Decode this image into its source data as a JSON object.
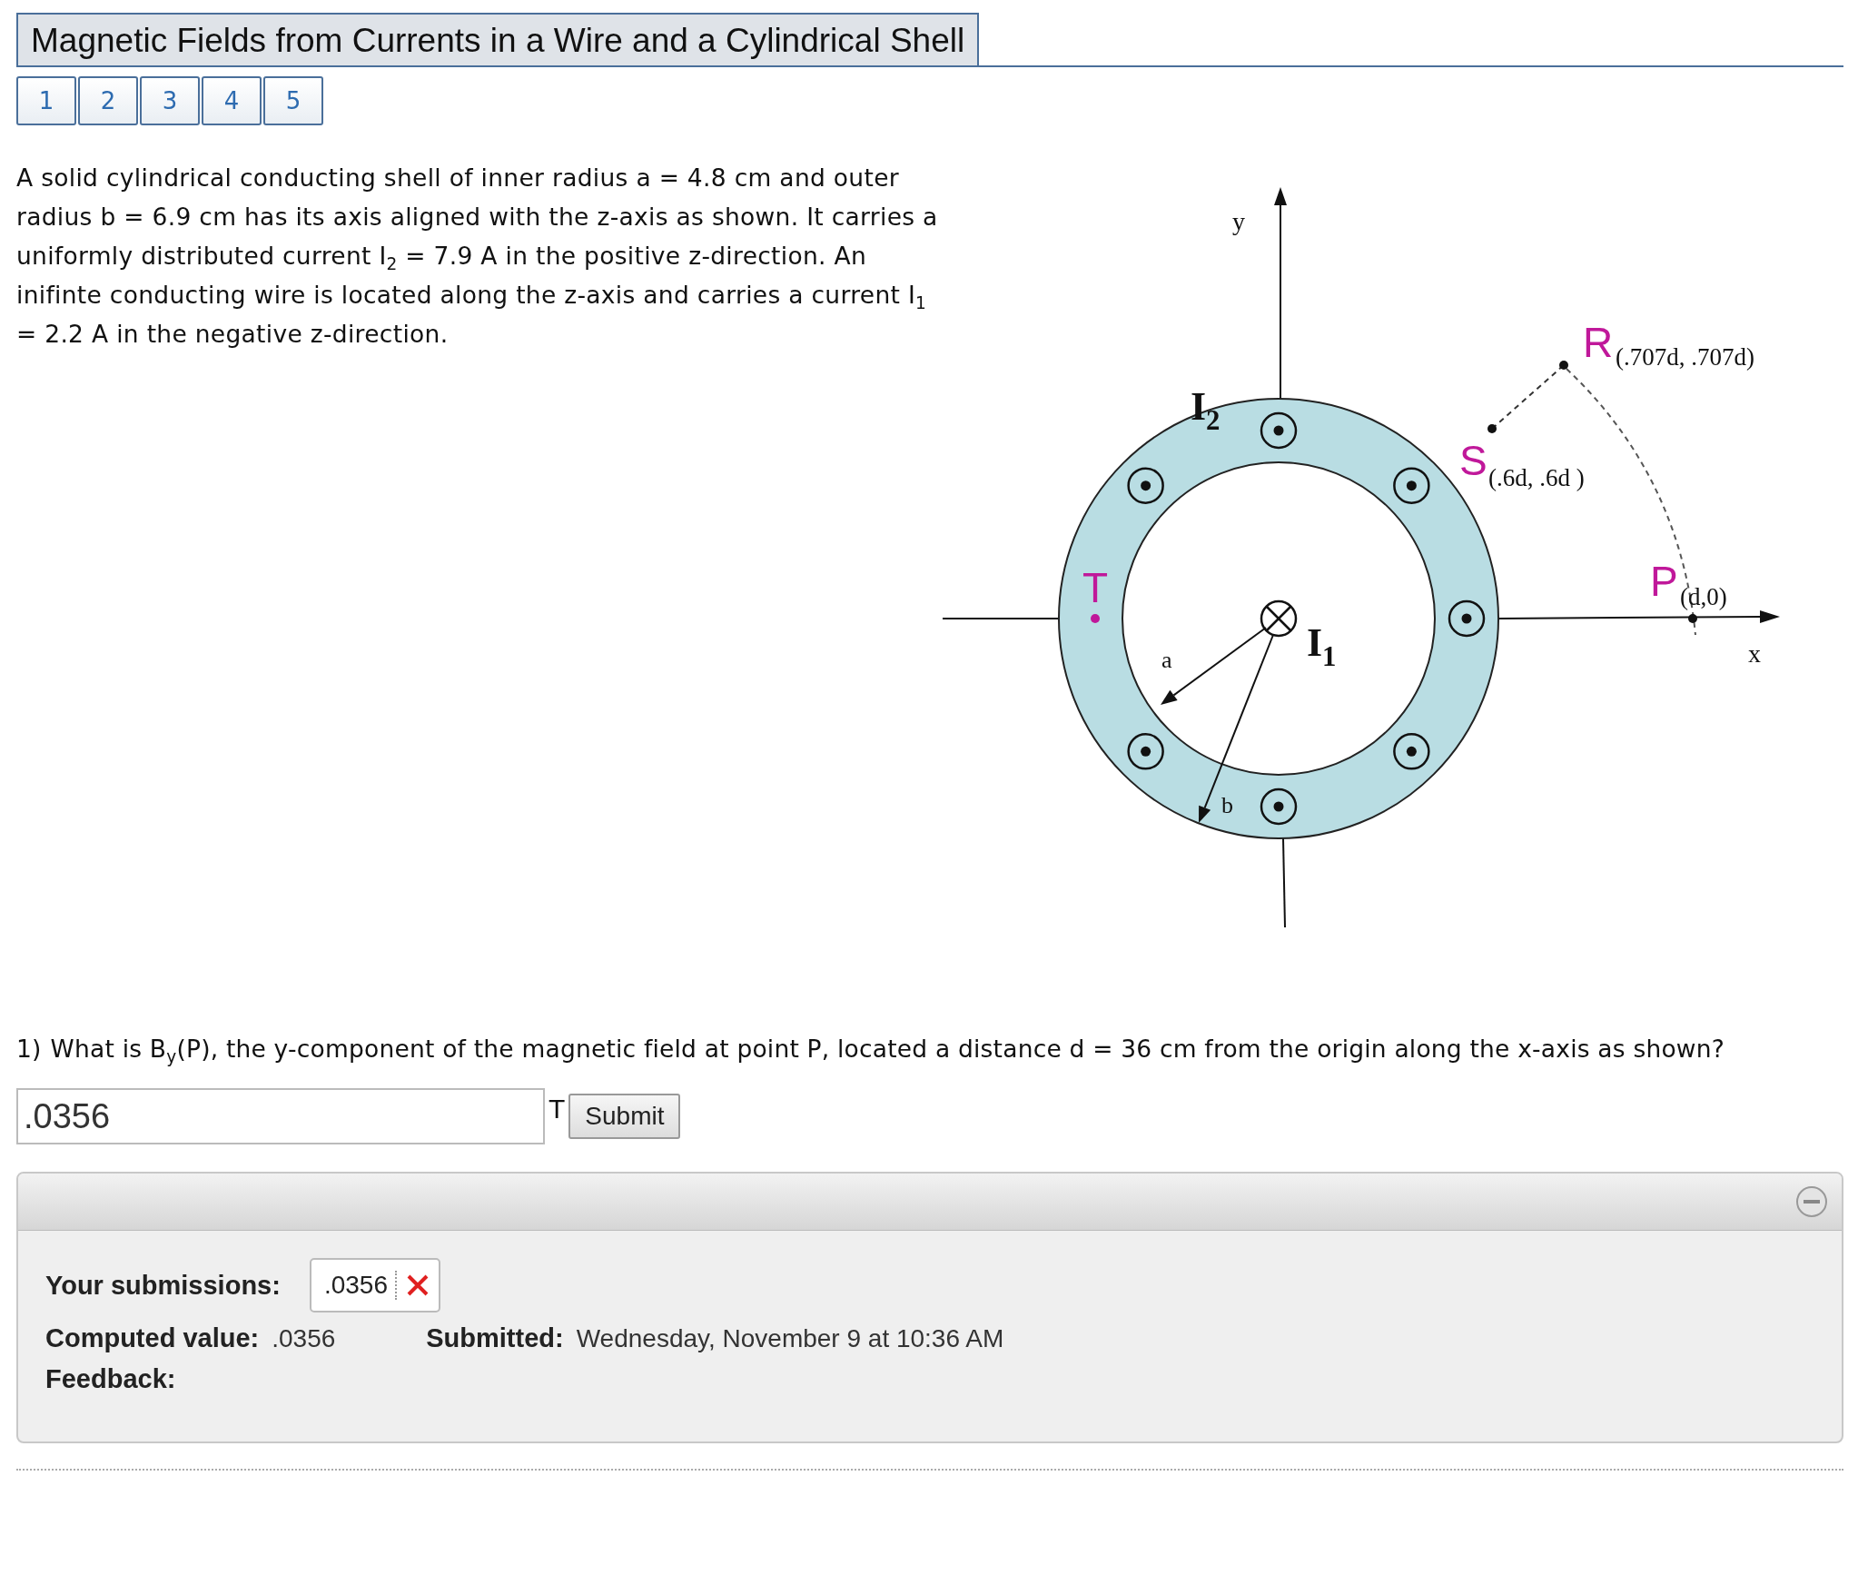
{
  "title": "Magnetic Fields from Currents in a Wire and a Cylindrical Shell",
  "tabs": [
    {
      "label": "1",
      "selected": false
    },
    {
      "label": "2",
      "selected": false
    },
    {
      "label": "3",
      "selected": false
    },
    {
      "label": "4",
      "selected": false
    },
    {
      "label": "5",
      "selected": false
    }
  ],
  "problem_text": "A solid cylindrical conducting shell of inner radius a = 4.8 cm and outer radius b = 6.9 cm has its axis aligned with the z-axis as shown. It carries a uniformly distributed current I$_{2}$ = 7.9 A in the positive z-direction. An inifinte conducting wire is located along the z-axis and carries a current I$_{1}$ = 2.2 A in the negative z-direction.",
  "diagram": {
    "y_label": "y",
    "x_label": "x",
    "currents": [
      {
        "label": "I$_{2}$"
      },
      {
        "label": "I$_{1}$"
      }
    ],
    "radii": [
      {
        "label": "a"
      },
      {
        "label": "b"
      }
    ],
    "points": [
      {
        "name": "R",
        "coords": "(.707d, .707d)"
      },
      {
        "name": "S",
        "coords": "(.6d, .6d )"
      },
      {
        "name": "P",
        "coords": "(d,0)"
      },
      {
        "name": "T"
      }
    ]
  },
  "question": {
    "number": "1)",
    "text": "What is B$_{y}$(P), the y-component of the magnetic field at point P, located a distance d = 36 cm from the origin along the x-axis as shown?",
    "answer": ".0356",
    "unit": "T",
    "submit": "Submit"
  },
  "results": {
    "expanded": true,
    "submissions_label": "Your submissions:",
    "submissions": [
      {
        "value": ".0356",
        "correct": false
      }
    ],
    "computed_label": "Computed value:",
    "computed_value": ".0356",
    "submitted_label": "Submitted:",
    "submitted_value": "Wednesday, November 9 at 10:36 AM",
    "feedback_label": "Feedback:"
  }
}
